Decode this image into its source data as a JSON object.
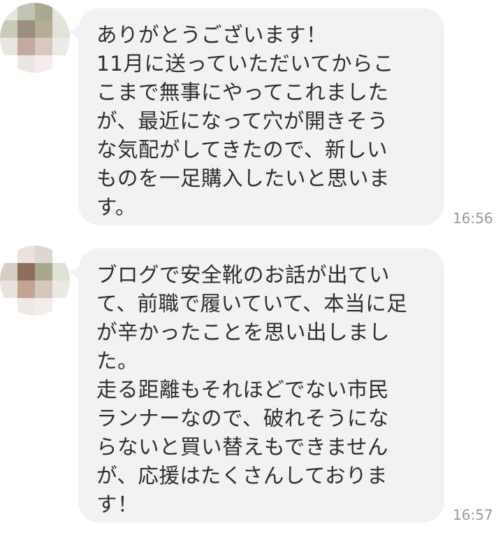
{
  "messages": [
    {
      "lines": [
        "ありがとうございます！",
        "11月に送っていただいてからこ",
        "こまで無事にやってこれました",
        "が、最近になって穴が開きそう",
        "な気配がしてきたので、新しい",
        "ものを一足購入したいと思いま",
        "す。"
      ],
      "time": "16:56",
      "avatar_colors": [
        "#e6e8df",
        "#bfc4b3",
        "#a9a98f",
        "#e5e4dc",
        "#c9ccbb",
        "#9c8f7d",
        "#b6ad97",
        "#e2e2d8",
        "#e8e6df",
        "#c3aaa0",
        "#d8c8c1",
        "#ecebe6",
        "#ffffff",
        "#ece6e3",
        "#f3eeec",
        "#ffffff"
      ]
    },
    {
      "lines": [
        "ブログで安全靴のお話が出てい",
        "て、前職で履いていて、本当に足",
        "が辛かったことを思い出しまし",
        "た。",
        "走る距離もそれほどでない市民",
        "ランナーなので、破れそうにな",
        "らないと買い替えもできません",
        "が、応援はたくさんしておりま",
        "す！"
      ],
      "time": "16:57",
      "avatar_colors": [
        "#ffffff",
        "#e9e3dc",
        "#dcd8cf",
        "#ffffff",
        "#d5cfc3",
        "#8f6e5d",
        "#a7a98e",
        "#dfe0d6",
        "#e8e3dc",
        "#c2a496",
        "#d6c6bd",
        "#ebe9e3",
        "#ffffff",
        "#efe9e6",
        "#f2edea",
        "#ffffff"
      ]
    }
  ]
}
